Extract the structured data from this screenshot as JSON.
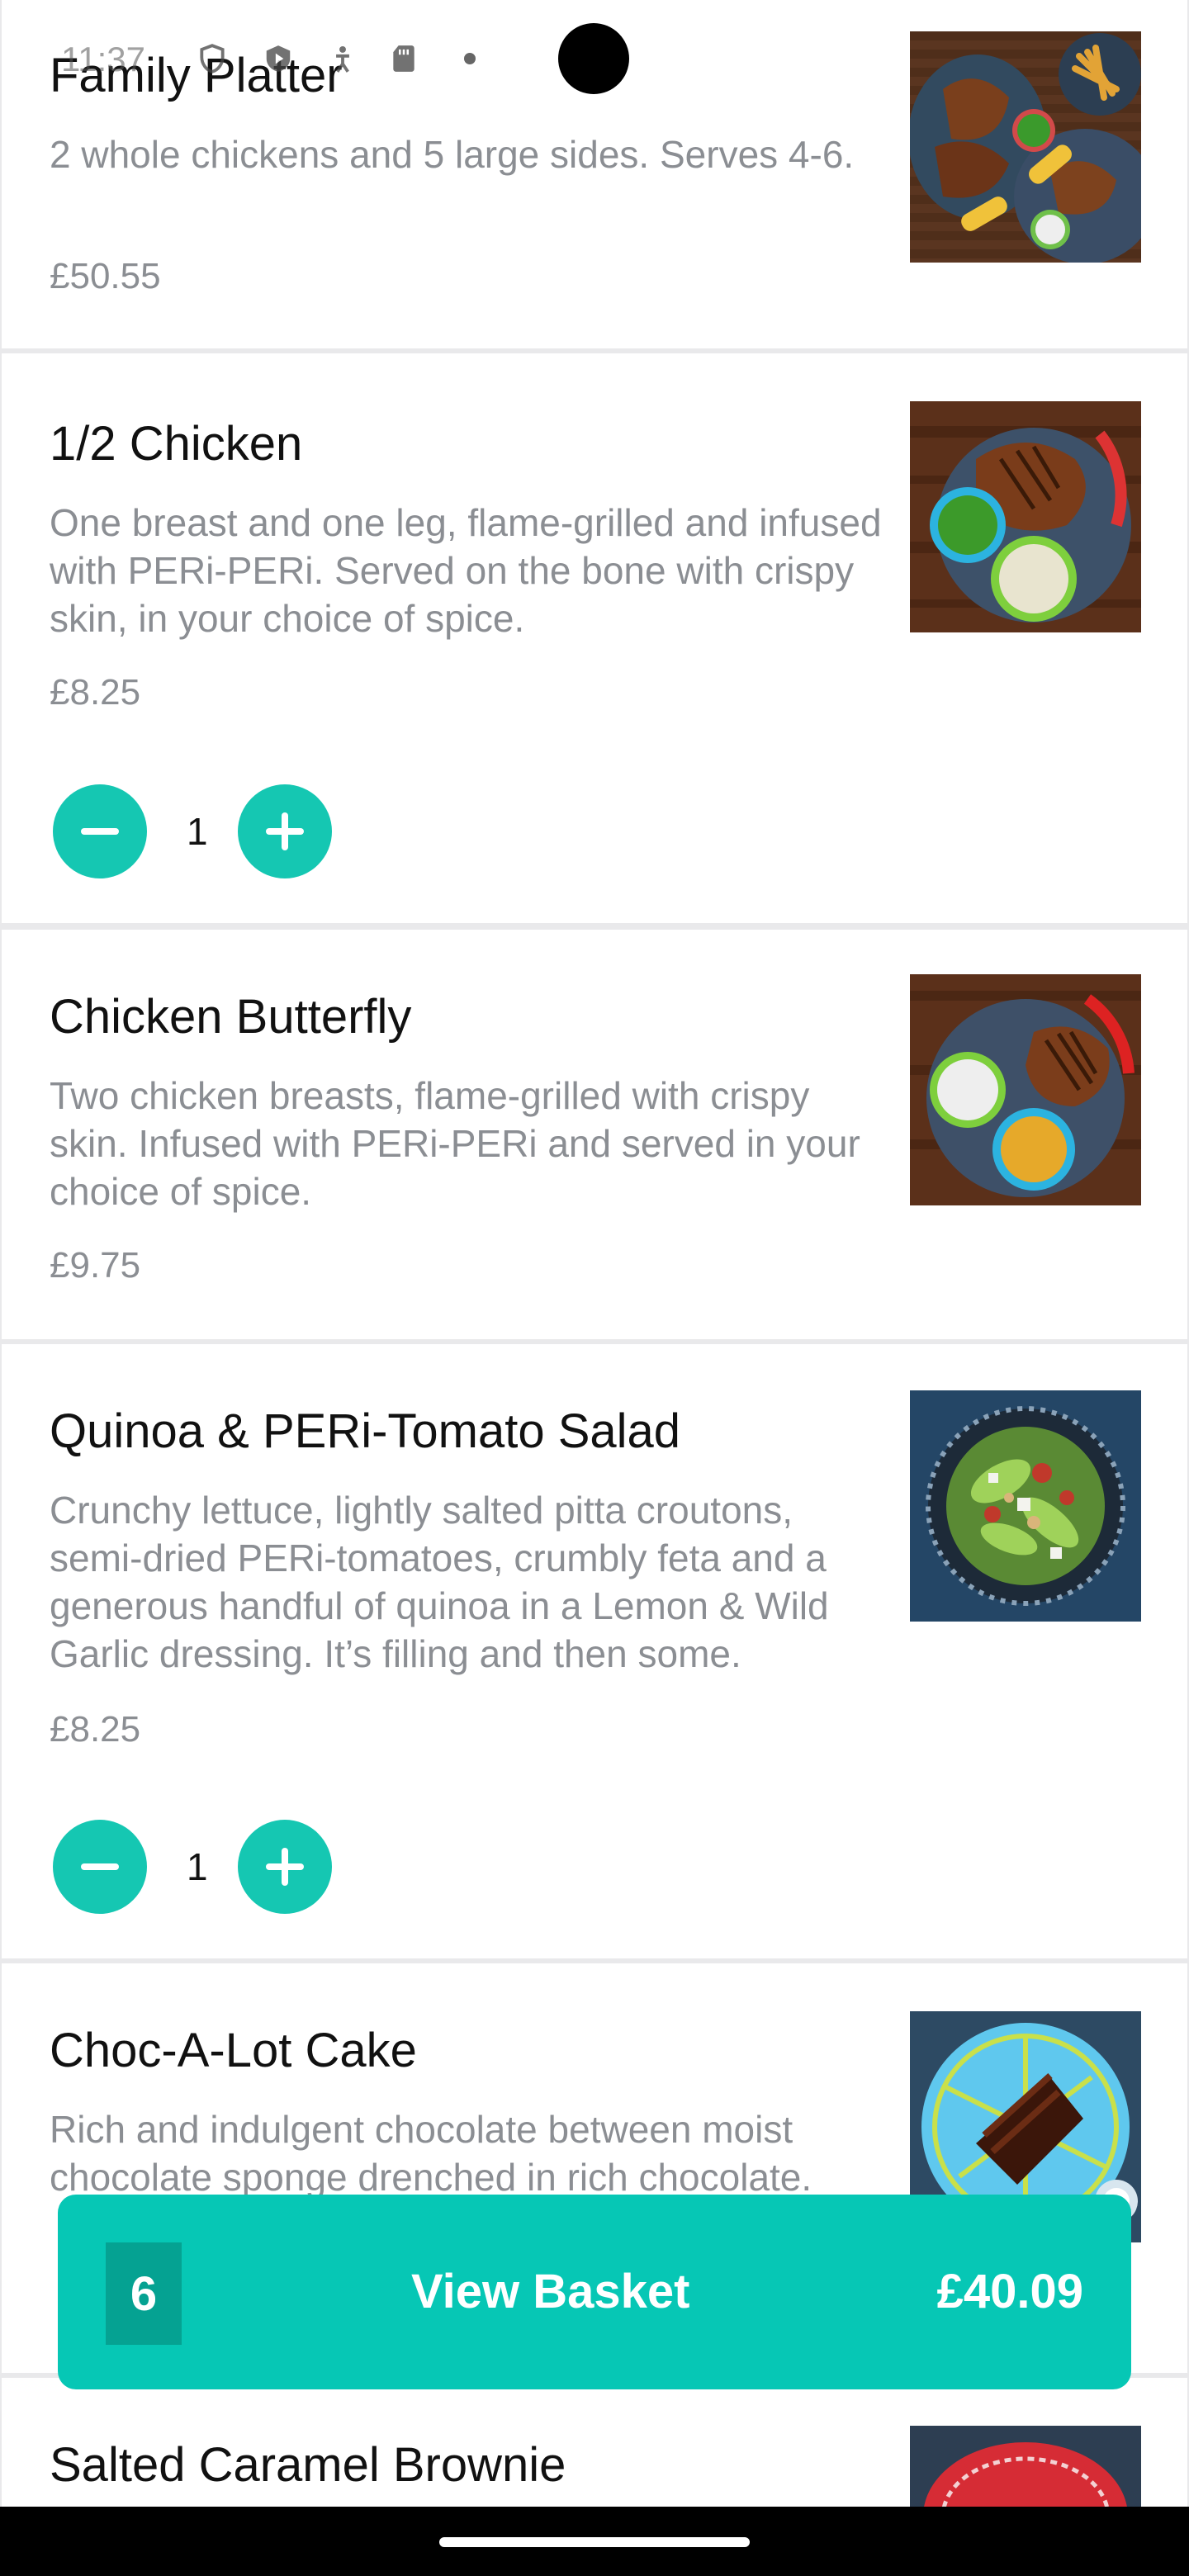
{
  "status_bar": {
    "time": "11:37"
  },
  "menu_items": [
    {
      "title": "Family Platter",
      "description": "2 whole chickens and 5 large sides. Serves 4-6.",
      "price": "£50.55"
    },
    {
      "title": "1/2 Chicken",
      "description": "One breast and one leg, flame-grilled and infused with PERi-PERi. Served on the bone with crispy skin, in your choice of spice.",
      "price": "£8.25",
      "quantity": "1"
    },
    {
      "title": "Chicken Butterfly",
      "description": "Two chicken breasts, flame-grilled with crispy skin. Infused with PERi-PERi and served in your choice of spice.",
      "price": "£9.75"
    },
    {
      "title": "Quinoa & PERi-Tomato Salad",
      "description": "Crunchy lettuce, lightly salted pitta croutons, semi-dried PERi-tomatoes, crumbly feta and a generous handful of quinoa in a Lemon & Wild Garlic dressing. It’s filling and then some.",
      "price": "£8.25",
      "quantity": "1"
    },
    {
      "title": "Choc-A-Lot Cake",
      "description": "Rich and indulgent chocolate between moist chocolate sponge drenched in rich chocolate.",
      "price": ""
    },
    {
      "title": "Salted Caramel Brownie"
    }
  ],
  "basket": {
    "count": "6",
    "label": "View Basket",
    "total": "£40.09"
  },
  "colors": {
    "accent": "#15c7b2",
    "accent_dark": "#05a292",
    "text": "#111111",
    "muted": "#8b8e93"
  }
}
